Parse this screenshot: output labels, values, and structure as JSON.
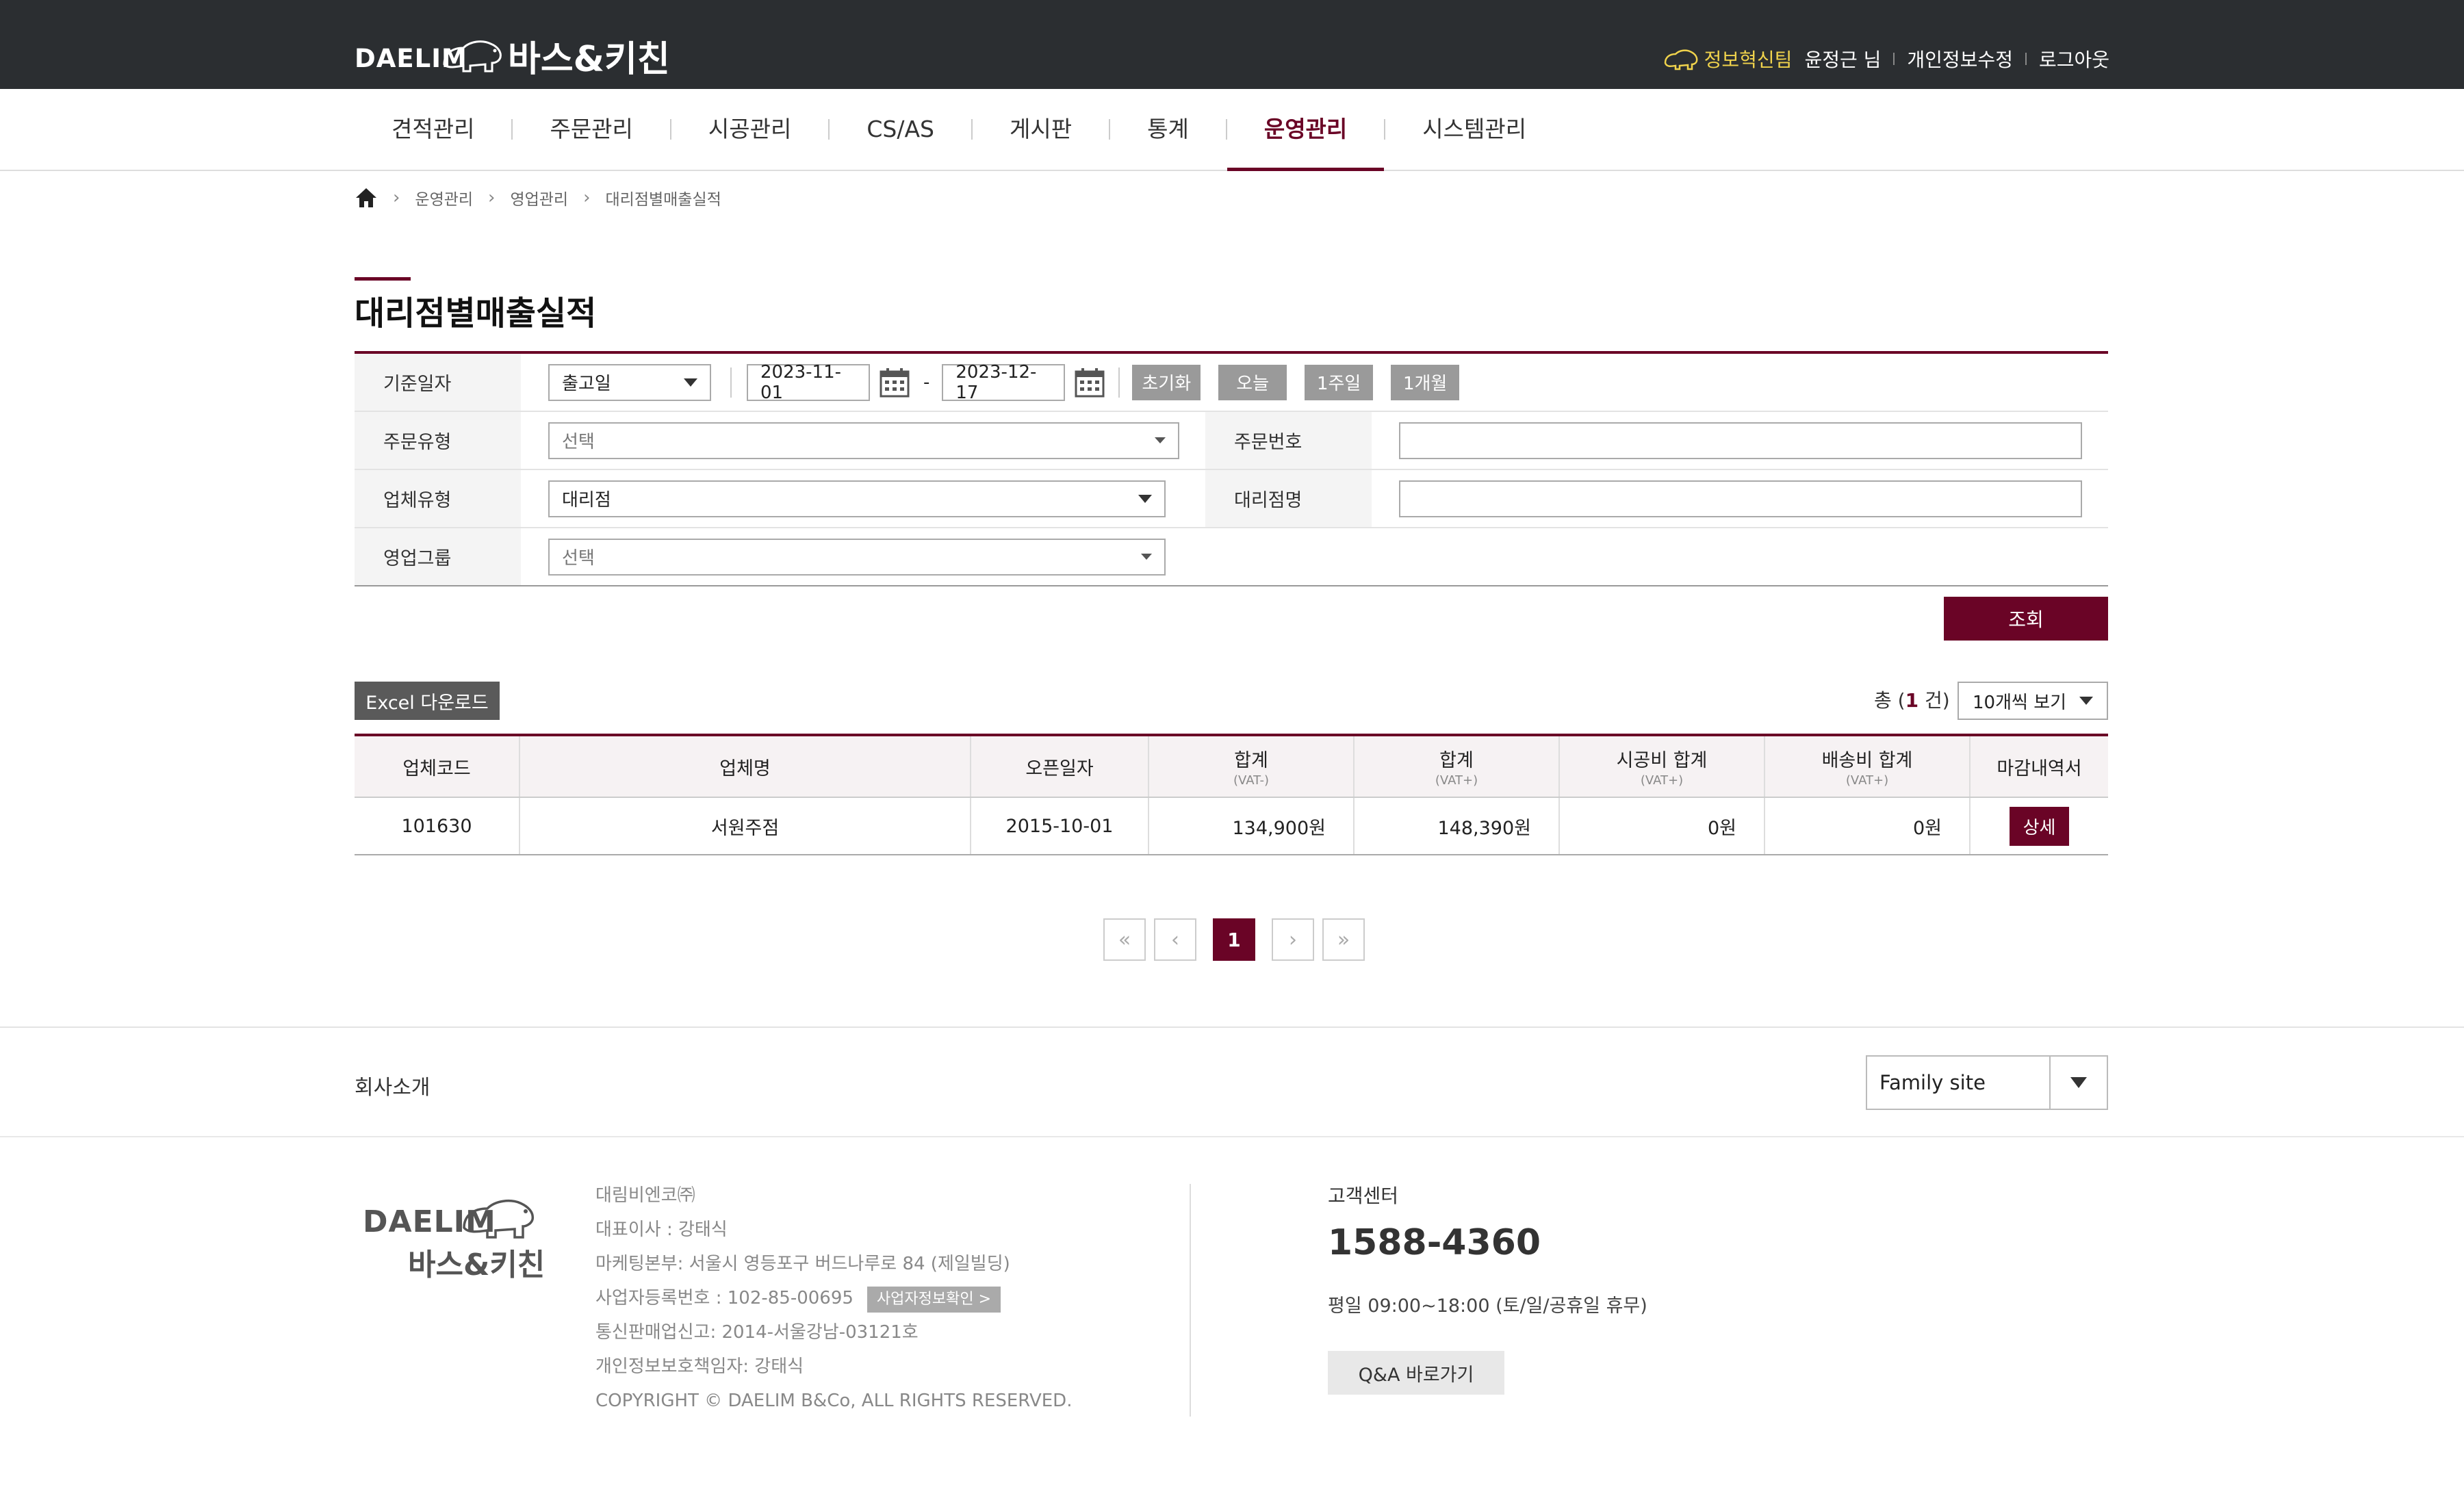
{
  "header": {
    "brand_en": "DAELIM",
    "brand_kr": "바스&키친",
    "innovation_team": "정보혁신팀",
    "user_name": "윤정근 님",
    "edit_profile": "개인정보수정",
    "logout": "로그아웃"
  },
  "nav": {
    "items": [
      {
        "label": "견적관리"
      },
      {
        "label": "주문관리"
      },
      {
        "label": "시공관리"
      },
      {
        "label": "CS/AS"
      },
      {
        "label": "게시판"
      },
      {
        "label": "통계"
      },
      {
        "label": "운영관리"
      },
      {
        "label": "시스템관리"
      }
    ],
    "active": "운영관리"
  },
  "breadcrumb": [
    "운영관리",
    "영업관리",
    "대리점별매출실적"
  ],
  "page_title": "대리점별매출실적",
  "search": {
    "date_label": "기준일자",
    "date_type": "출고일",
    "date_from": "2023-11-01",
    "date_sep": "-",
    "date_to": "2023-12-17",
    "btn_reset": "초기화",
    "btn_today": "오늘",
    "btn_week": "1주일",
    "btn_month": "1개월",
    "order_type_label": "주문유형",
    "order_type_value": "선택",
    "order_no_label": "주문번호",
    "order_no_value": "",
    "company_type_label": "업체유형",
    "company_type_value": "대리점",
    "agency_name_label": "대리점명",
    "agency_name_value": "",
    "sales_group_label": "영업그룹",
    "sales_group_value": "선택",
    "search_button": "조회"
  },
  "toolbar": {
    "excel": "Excel 다운로드",
    "total_prefix": "총 (",
    "total_count": "1",
    "total_suffix": " 건)",
    "page_size": "10개씩 보기"
  },
  "table": {
    "headers": [
      {
        "label": "업체코드",
        "sub": ""
      },
      {
        "label": "업체명",
        "sub": ""
      },
      {
        "label": "오픈일자",
        "sub": ""
      },
      {
        "label": "합계",
        "sub": "(VAT-)"
      },
      {
        "label": "합계",
        "sub": "(VAT+)"
      },
      {
        "label": "시공비 합계",
        "sub": "(VAT+)"
      },
      {
        "label": "배송비 합계",
        "sub": "(VAT+)"
      },
      {
        "label": "마감내역서",
        "sub": ""
      }
    ],
    "rows": [
      {
        "code": "101630",
        "name": "서원주점",
        "open_date": "2015-10-01",
        "total_ex": "134,900원",
        "total_inc": "148,390원",
        "install": "0원",
        "delivery": "0원",
        "action": "상세"
      }
    ]
  },
  "pagination": {
    "current": "1"
  },
  "footer": {
    "company_intro": "회사소개",
    "family_site": "Family site",
    "logo_en": "DAELIM",
    "logo_kr": "바스&키친",
    "company_name": "대림비엔코㈜",
    "ceo": "대표이사 : 강태식",
    "address": "마케팅본부: 서울시 영등포구 버드나루로 84 (제일빌딩)",
    "biz_no": "사업자등록번호 : 102-85-00695",
    "biz_confirm": "사업자정보확인 >",
    "ecommerce": "통신판매업신고: 2014-서울강남-03121호",
    "privacy_officer": "개인정보보호책임자: 강태식",
    "copyright": "COPYRIGHT © DAELIM B&Co, ALL RIGHTS RESERVED.",
    "cs_title": "고객센터",
    "cs_phone": "1588-4360",
    "cs_hours": "평일 09:00~18:00 (토/일/공휴일 휴무)",
    "qa_button": "Q&A 바로가기"
  },
  "colors": {
    "brand": "#6a0426",
    "topbar": "#2b2e31",
    "highlight": "#f0d34c"
  }
}
